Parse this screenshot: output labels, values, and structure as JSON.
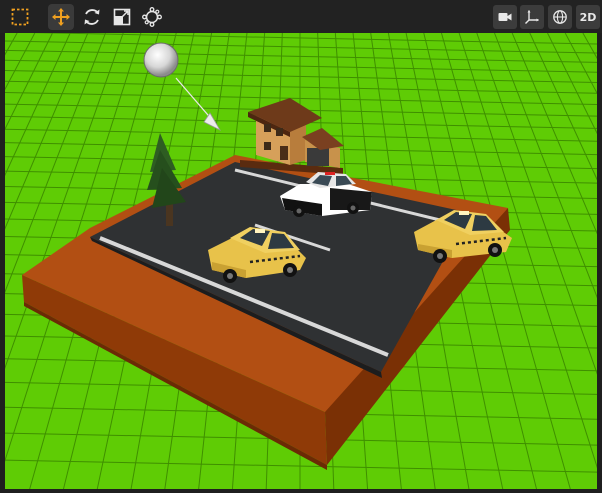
{
  "toolbar": {
    "left_tools": [
      {
        "icon": "select-marquee-icon",
        "active": false
      },
      {
        "icon": "move-arrows-icon",
        "active": true
      },
      {
        "icon": "rotate-icon",
        "active": false
      },
      {
        "icon": "scale-icon",
        "active": false
      },
      {
        "icon": "transform-gizmo-icon",
        "active": false
      }
    ],
    "right_tools": {
      "camera_icon": "camera-icon",
      "axes_icon": "axes-icon",
      "globe_icon": "globe-icon",
      "mode_2d_label": "2D"
    },
    "accent_color": "#f0a020"
  },
  "viewport": {
    "ground_color": "#5fcc05",
    "grid_color": "#3f8f00",
    "road_color": "#2f3133",
    "dirt_color": "#a6480f",
    "objects": [
      "directional-light",
      "house",
      "pine-tree",
      "police-car",
      "taxi-car",
      "taxi-car"
    ]
  }
}
